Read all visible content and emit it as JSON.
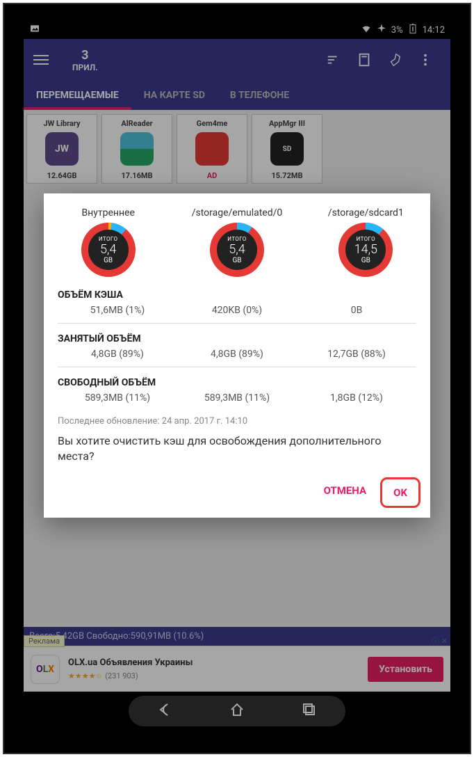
{
  "status": {
    "battery": "3%",
    "time": "14:12"
  },
  "toolbar": {
    "count": "3",
    "count_label": "ПРИЛ."
  },
  "tabs": {
    "t1": "ПЕРЕМЕЩАЕМЫЕ",
    "t2": "НА КАРТЕ SD",
    "t3": "В ТЕЛЕФОНЕ"
  },
  "apps": [
    {
      "name": "JW Library",
      "size": "12.64GB"
    },
    {
      "name": "AlReader",
      "size": "17.16MB"
    },
    {
      "name": "Gem4me",
      "size": "AD"
    },
    {
      "name": "AppMgr III",
      "size": "15.72MB"
    }
  ],
  "dialog": {
    "ring_total": "ИТОГО",
    "storages": [
      {
        "label": "Внутреннее",
        "val": "5,4",
        "unit": "GB"
      },
      {
        "label": "/storage/emulated/0",
        "val": "5,4",
        "unit": "GB"
      },
      {
        "label": "/storage/sdcard1",
        "val": "14,5",
        "unit": "GB"
      }
    ],
    "h_cache": "ОБЪЁМ КЭША",
    "cache": [
      "51,6MB (1%)",
      "420KB (0%)",
      "0B"
    ],
    "h_used": "ЗАНЯТЫЙ ОБЪЁМ",
    "used": [
      "4,8GB (89%)",
      "4,8GB (89%)",
      "12,7GB (88%)"
    ],
    "h_free": "СВОБОДНЫЙ ОБЪЁМ",
    "free": [
      "589,3MB (11%)",
      "589,3MB (11%)",
      "1,8GB (12%)"
    ],
    "updated": "Последнее обновление: 24 апр. 2017 г. 14:10",
    "question": "Вы хотите очистить кэш для освобождения дополнительного места?",
    "cancel": "ОТМЕНА",
    "ok": "OK"
  },
  "bottom": "Всего:5,42GB Свободно:590,91MB (10.6%)",
  "ad": {
    "badge": "Реклама",
    "title": "OLX.ua Объявления Украины",
    "stars": "★★★★☆",
    "count": "(231 903)",
    "install": "Установить"
  }
}
